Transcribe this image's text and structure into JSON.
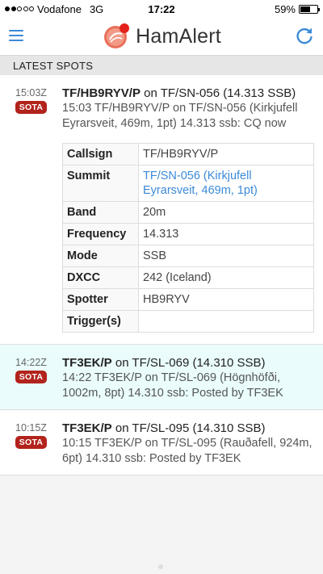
{
  "status_bar": {
    "carrier": "Vodafone",
    "network": "3G",
    "time": "17:22",
    "battery": "59%",
    "battery_level": 0.59,
    "signal_bars": 2
  },
  "header": {
    "app_name": "HamAlert",
    "menu_icon": "hamburger-menu-icon",
    "refresh_icon": "refresh-icon",
    "accent_color": "#3b8ad8"
  },
  "section": {
    "title": "LATEST SPOTS"
  },
  "spots": [
    {
      "time": "15:03Z",
      "badge": "SOTA",
      "callsign": "TF/HB9RYV/P",
      "title_rest": " on TF/SN-056 (14.313 SSB)",
      "comment": "15:03 TF/HB9RYV/P on TF/SN-056 (Kirkjufell Eyrarsveit, 469m, 1pt) 14.313 ssb: CQ now",
      "details": [
        {
          "label": "Callsign",
          "value": "TF/HB9RYV/P"
        },
        {
          "label": "Summit",
          "value": "TF/SN-056 (Kirkjufell Eyrarsveit, 469m, 1pt)"
        },
        {
          "label": "Band",
          "value": "20m"
        },
        {
          "label": "Frequency",
          "value": "14.313"
        },
        {
          "label": "Mode",
          "value": "SSB"
        },
        {
          "label": "DXCC",
          "value": "242 (Iceland)"
        },
        {
          "label": "Spotter",
          "value": "HB9RYV"
        },
        {
          "label": "Trigger(s)",
          "value": ""
        }
      ]
    },
    {
      "time": "14:22Z",
      "badge": "SOTA",
      "callsign": "TF3EK/P",
      "title_rest": " on TF/SL-069 (14.310 SSB)",
      "comment": "14:22 TF3EK/P on TF/SL-069 (Högnhöfði, 1002m, 8pt) 14.310 ssb: Posted by TF3EK"
    },
    {
      "time": "10:15Z",
      "badge": "SOTA",
      "callsign": "TF3EK/P",
      "title_rest": " on TF/SL-095 (14.310 SSB)",
      "comment": "10:15 TF3EK/P on TF/SL-095 (Rauðafell, 924m, 6pt) 14.310 ssb: Posted by TF3EK"
    }
  ],
  "colors": {
    "badge": "#b2231c",
    "highlight_row": "#eafcfc",
    "link": "#3b8ad8"
  }
}
